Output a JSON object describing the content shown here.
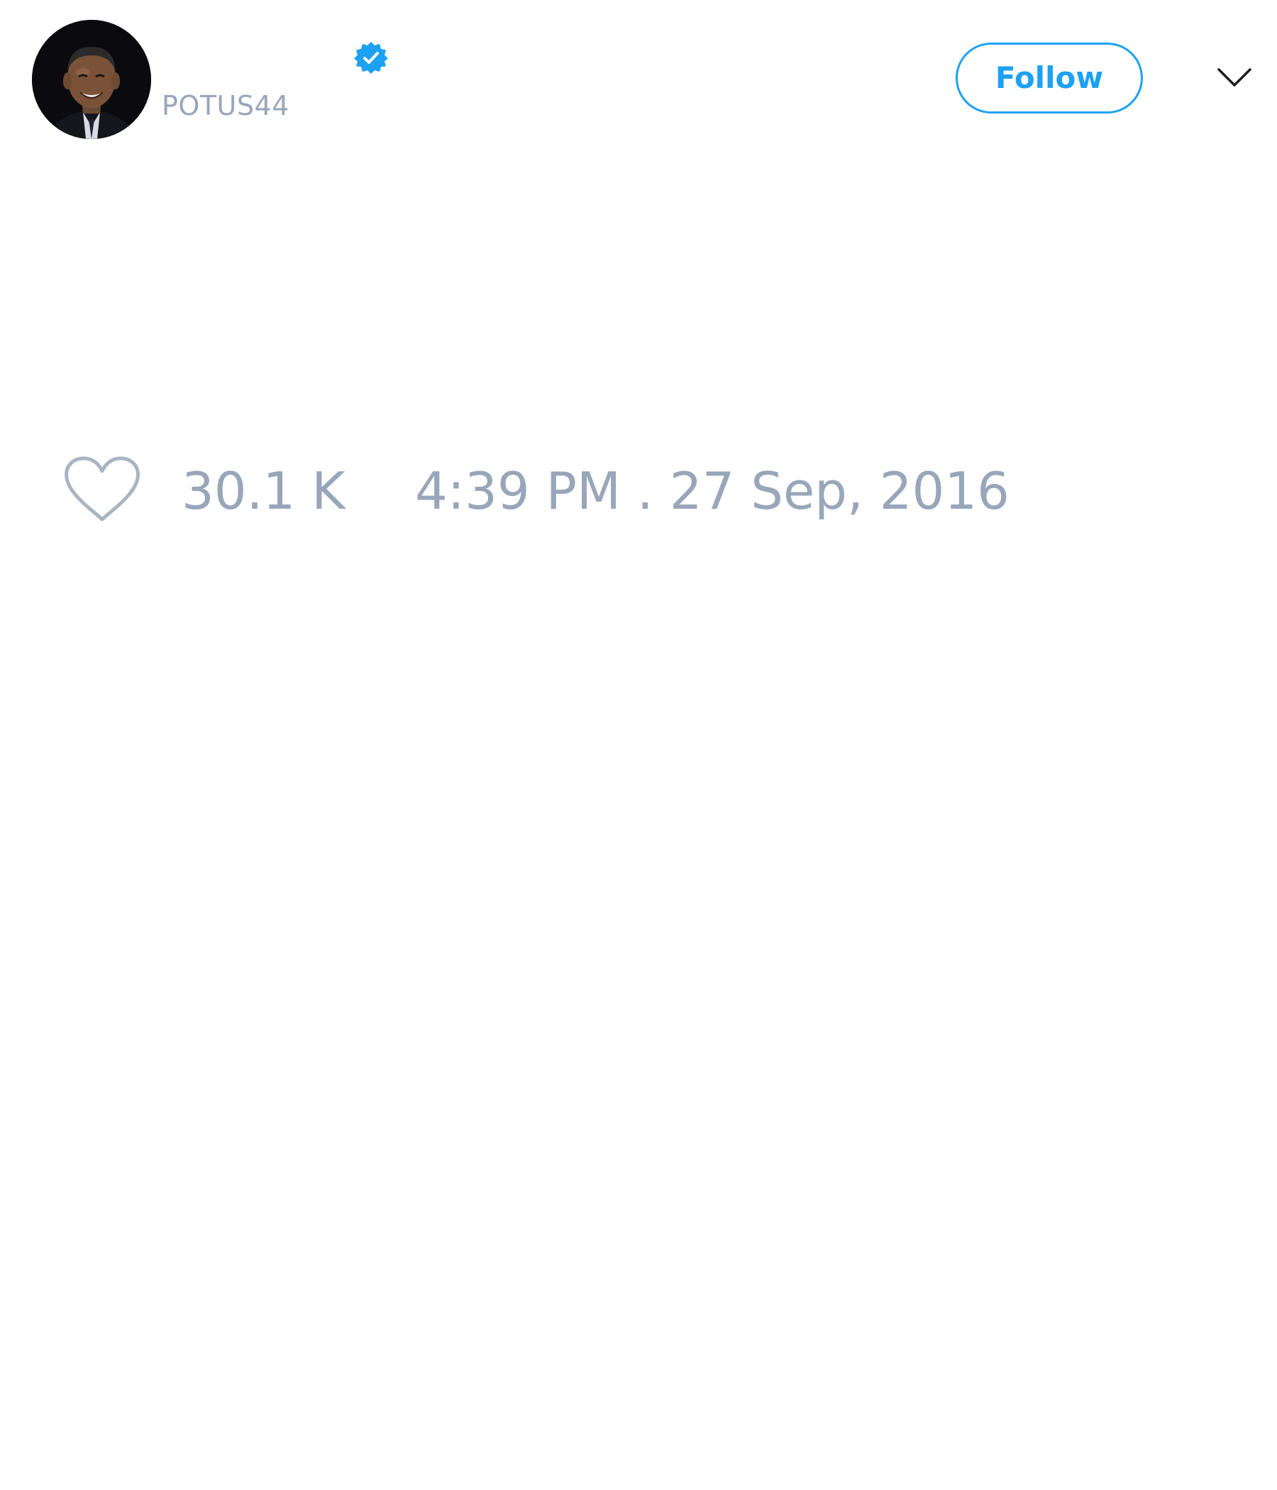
{
  "tweet": {
    "author": {
      "display_name": "",
      "handle": "POTUS44",
      "avatar_icon": "profile-photo",
      "verified": true,
      "verified_icon": "verified-badge-icon"
    },
    "follow_label": "Follow",
    "more_icon": "chevron-down-icon",
    "likes": {
      "icon": "heart-outline-icon",
      "count": "30.1 K"
    },
    "timestamp": "4:39 PM . 27 Sep, 2016"
  },
  "colors": {
    "accent": "#1da1f2",
    "muted_text": "#98a6b9",
    "background": "#ffffff",
    "icon_stroke": "#a9b4c2"
  }
}
